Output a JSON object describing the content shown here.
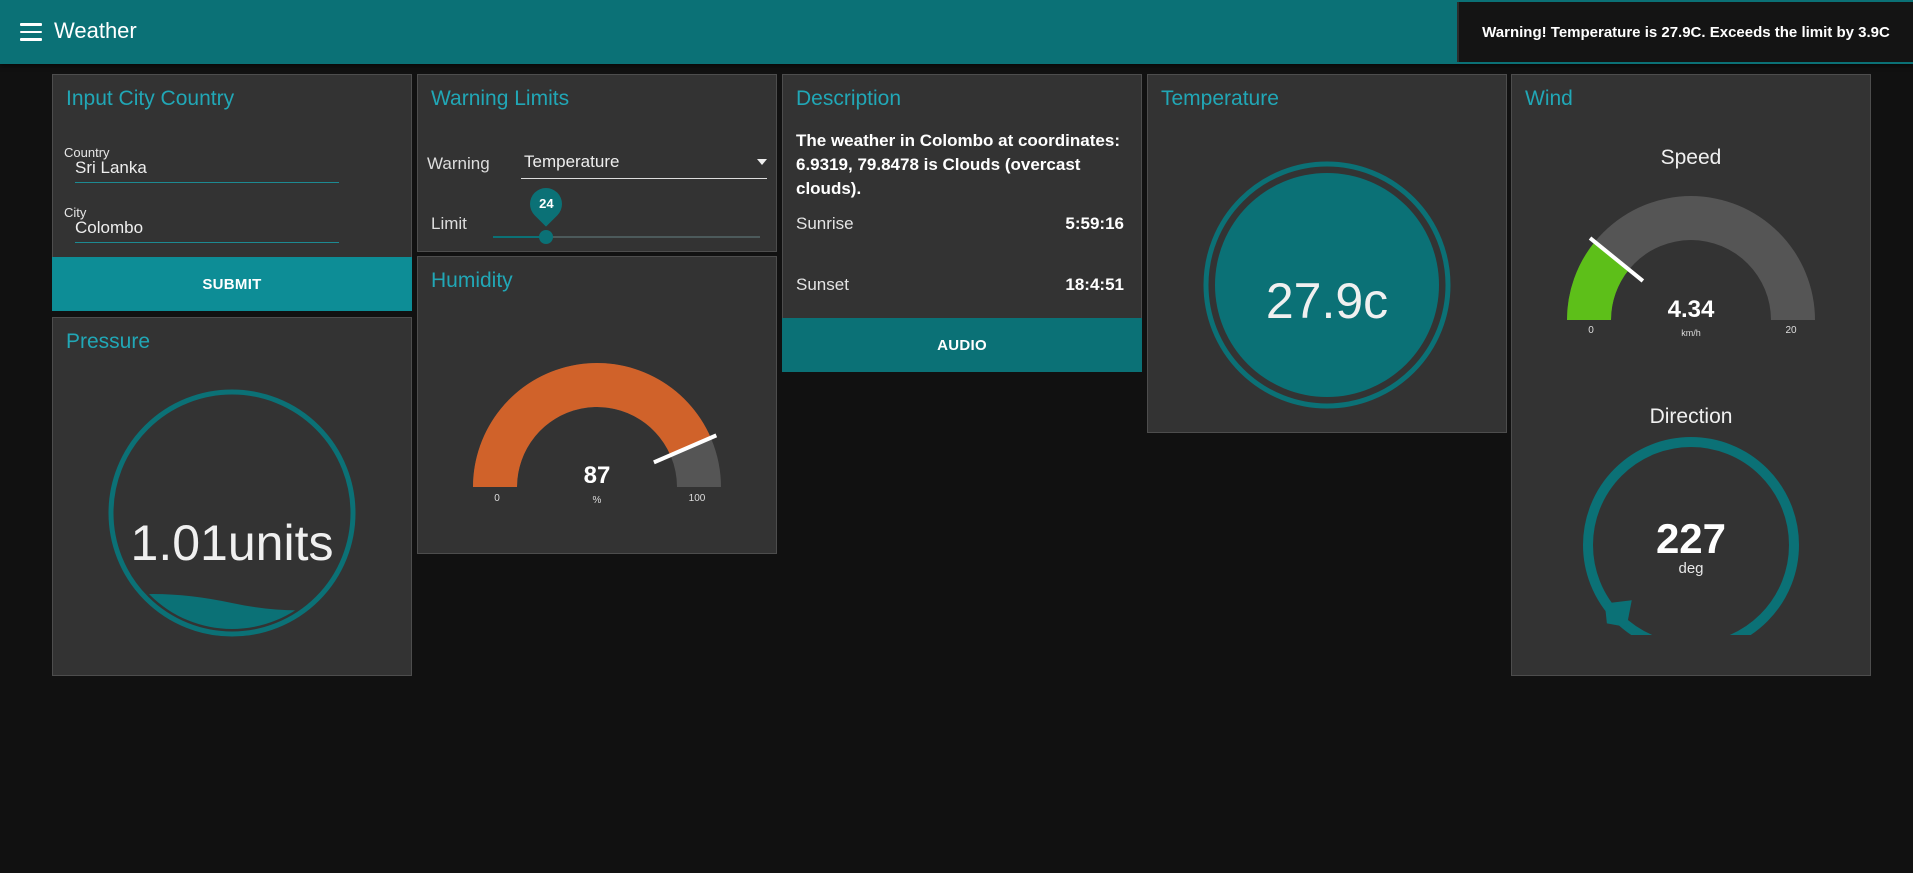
{
  "app": {
    "title": "Weather"
  },
  "toast": {
    "message": "Warning! Temperature is 27.9C. Exceeds the limit by 3.9C"
  },
  "input_card": {
    "title": "Input City Country",
    "country_label": "Country",
    "country_value": "Sri Lanka",
    "city_label": "City",
    "city_value": "Colombo",
    "submit_label": "SUBMIT"
  },
  "pressure": {
    "title": "Pressure",
    "display": "1.01units",
    "level": 0.1
  },
  "warning": {
    "title": "Warning Limits",
    "warning_label": "Warning",
    "selected": "Temperature",
    "limit_label": "Limit",
    "limit_value": "24",
    "limit_fraction": 0.2
  },
  "humidity": {
    "title": "Humidity",
    "value": "87",
    "units": "%",
    "min": "0",
    "max": "100",
    "fraction": 0.87,
    "color": "#d0622a"
  },
  "description": {
    "title": "Description",
    "text": "The weather in Colombo at coordinates: 6.9319, 79.8478 is Clouds (overcast clouds).",
    "sunrise_label": "Sunrise",
    "sunrise_value": "5:59:16",
    "sunset_label": "Sunset",
    "sunset_value": "18:4:51",
    "audio_label": "AUDIO"
  },
  "temperature": {
    "title": "Temperature",
    "display": "27.9c"
  },
  "wind": {
    "title": "Wind",
    "speed_title": "Speed",
    "speed_value": "4.34",
    "speed_units": "km/h",
    "speed_min": "0",
    "speed_max": "20",
    "speed_fraction": 0.217,
    "speed_color": "#5dbf19",
    "direction_title": "Direction",
    "direction_value": "227",
    "direction_units": "deg",
    "direction_degrees": 227
  },
  "colors": {
    "accent": "#0b7176",
    "title_color": "#21a7b6",
    "card_bg": "#333333",
    "page_bg": "#111111",
    "gauge_bg": "#555555"
  }
}
